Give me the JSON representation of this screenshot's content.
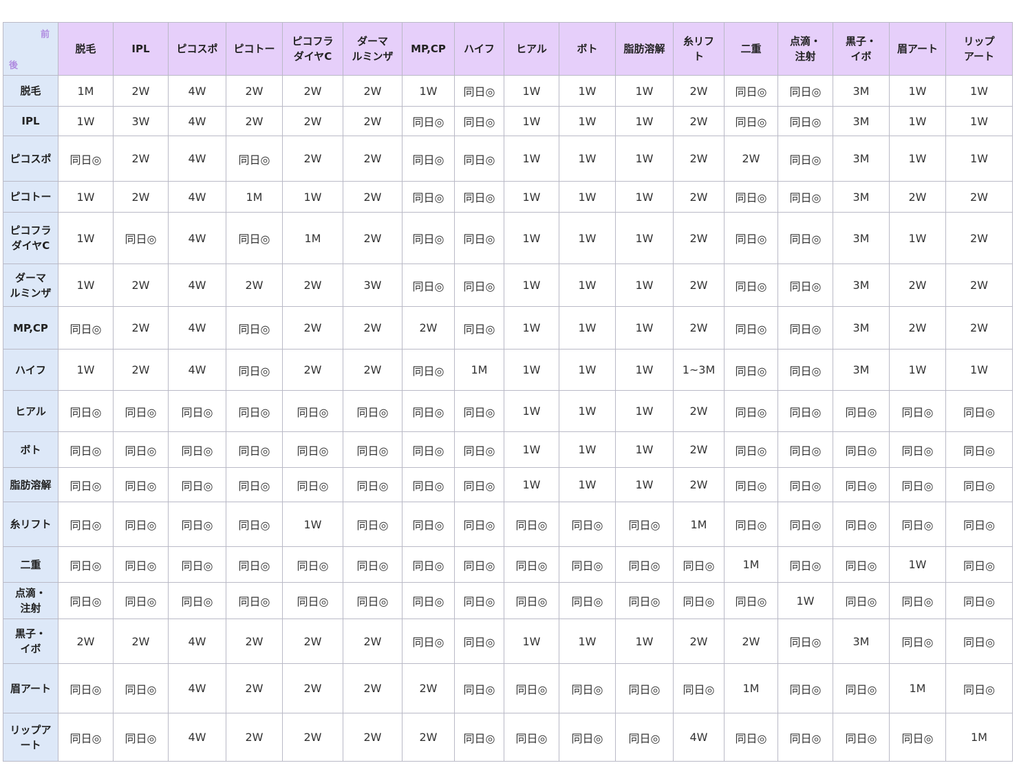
{
  "table": {
    "corner": {
      "before": "前",
      "after": "後"
    },
    "columns": [
      "脱毛",
      "IPL",
      "ピコスポ",
      "ピコトー",
      "ピコフラ\nダイヤC",
      "ダーマ\nルミンザ",
      "MP,CP",
      "ハイフ",
      "ヒアル",
      "ボト",
      "脂肪溶解",
      "糸リフ\nト",
      "二重",
      "点滴・\n注射",
      "黒子・\nイボ",
      "眉アート",
      "リップ\nアート"
    ],
    "rows": [
      {
        "label": "脱毛",
        "cells": [
          "1M",
          "2W",
          "4W",
          "2W",
          "2W",
          "2W",
          "1W",
          "同日◎",
          "1W",
          "1W",
          "1W",
          "2W",
          "同日◎",
          "同日◎",
          "3M",
          "1W",
          "1W"
        ]
      },
      {
        "label": "IPL",
        "cells": [
          "1W",
          "3W",
          "4W",
          "2W",
          "2W",
          "2W",
          "同日◎",
          "同日◎",
          "1W",
          "1W",
          "1W",
          "2W",
          "同日◎",
          "同日◎",
          "3M",
          "1W",
          "1W"
        ]
      },
      {
        "label": "ピコスポ",
        "cells": [
          "同日◎",
          "2W",
          "4W",
          "同日◎",
          "2W",
          "2W",
          "同日◎",
          "同日◎",
          "1W",
          "1W",
          "1W",
          "2W",
          "2W",
          "同日◎",
          "3M",
          "1W",
          "1W"
        ]
      },
      {
        "label": "ピコトー",
        "cells": [
          "1W",
          "2W",
          "4W",
          "1M",
          "1W",
          "2W",
          "同日◎",
          "同日◎",
          "1W",
          "1W",
          "1W",
          "2W",
          "同日◎",
          "同日◎",
          "3M",
          "2W",
          "2W"
        ]
      },
      {
        "label": "ピコフラ\nダイヤC",
        "cells": [
          "1W",
          "同日◎",
          "4W",
          "同日◎",
          "1M",
          "2W",
          "同日◎",
          "同日◎",
          "1W",
          "1W",
          "1W",
          "2W",
          "同日◎",
          "同日◎",
          "3M",
          "1W",
          "2W"
        ]
      },
      {
        "label": "ダーマ\nルミンザ",
        "cells": [
          "1W",
          "2W",
          "4W",
          "2W",
          "2W",
          "3W",
          "同日◎",
          "同日◎",
          "1W",
          "1W",
          "1W",
          "2W",
          "同日◎",
          "同日◎",
          "3M",
          "2W",
          "2W"
        ]
      },
      {
        "label": "MP,CP",
        "cells": [
          "同日◎",
          "2W",
          "4W",
          "同日◎",
          "2W",
          "2W",
          "2W",
          "同日◎",
          "1W",
          "1W",
          "1W",
          "2W",
          "同日◎",
          "同日◎",
          "3M",
          "2W",
          "2W"
        ]
      },
      {
        "label": "ハイフ",
        "cells": [
          "1W",
          "2W",
          "4W",
          "同日◎",
          "2W",
          "2W",
          "同日◎",
          "1M",
          "1W",
          "1W",
          "1W",
          "1~3M",
          "同日◎",
          "同日◎",
          "3M",
          "1W",
          "1W"
        ]
      },
      {
        "label": "ヒアル",
        "cells": [
          "同日◎",
          "同日◎",
          "同日◎",
          "同日◎",
          "同日◎",
          "同日◎",
          "同日◎",
          "同日◎",
          "1W",
          "1W",
          "1W",
          "2W",
          "同日◎",
          "同日◎",
          "同日◎",
          "同日◎",
          "同日◎"
        ]
      },
      {
        "label": "ボト",
        "cells": [
          "同日◎",
          "同日◎",
          "同日◎",
          "同日◎",
          "同日◎",
          "同日◎",
          "同日◎",
          "同日◎",
          "1W",
          "1W",
          "1W",
          "2W",
          "同日◎",
          "同日◎",
          "同日◎",
          "同日◎",
          "同日◎"
        ]
      },
      {
        "label": "脂肪溶解",
        "cells": [
          "同日◎",
          "同日◎",
          "同日◎",
          "同日◎",
          "同日◎",
          "同日◎",
          "同日◎",
          "同日◎",
          "1W",
          "1W",
          "1W",
          "2W",
          "同日◎",
          "同日◎",
          "同日◎",
          "同日◎",
          "同日◎"
        ]
      },
      {
        "label": "糸リフト",
        "cells": [
          "同日◎",
          "同日◎",
          "同日◎",
          "同日◎",
          "1W",
          "同日◎",
          "同日◎",
          "同日◎",
          "同日◎",
          "同日◎",
          "同日◎",
          "1M",
          "同日◎",
          "同日◎",
          "同日◎",
          "同日◎",
          "同日◎"
        ]
      },
      {
        "label": "二重",
        "cells": [
          "同日◎",
          "同日◎",
          "同日◎",
          "同日◎",
          "同日◎",
          "同日◎",
          "同日◎",
          "同日◎",
          "同日◎",
          "同日◎",
          "同日◎",
          "同日◎",
          "1M",
          "同日◎",
          "同日◎",
          "1W",
          "同日◎"
        ]
      },
      {
        "label": "点滴・\n注射",
        "cells": [
          "同日◎",
          "同日◎",
          "同日◎",
          "同日◎",
          "同日◎",
          "同日◎",
          "同日◎",
          "同日◎",
          "同日◎",
          "同日◎",
          "同日◎",
          "同日◎",
          "同日◎",
          "1W",
          "同日◎",
          "同日◎",
          "同日◎"
        ]
      },
      {
        "label": "黒子・\nイボ",
        "cells": [
          "2W",
          "2W",
          "4W",
          "2W",
          "2W",
          "2W",
          "同日◎",
          "同日◎",
          "1W",
          "1W",
          "1W",
          "2W",
          "2W",
          "同日◎",
          "3M",
          "同日◎",
          "同日◎"
        ]
      },
      {
        "label": "眉アート",
        "cells": [
          "同日◎",
          "同日◎",
          "4W",
          "2W",
          "2W",
          "2W",
          "2W",
          "同日◎",
          "同日◎",
          "同日◎",
          "同日◎",
          "同日◎",
          "1M",
          "同日◎",
          "同日◎",
          "1M",
          "同日◎"
        ]
      },
      {
        "label": "リップア\nート",
        "cells": [
          "同日◎",
          "同日◎",
          "4W",
          "2W",
          "2W",
          "2W",
          "2W",
          "同日◎",
          "同日◎",
          "同日◎",
          "同日◎",
          "4W",
          "同日◎",
          "同日◎",
          "同日◎",
          "同日◎",
          "1M"
        ]
      }
    ]
  }
}
